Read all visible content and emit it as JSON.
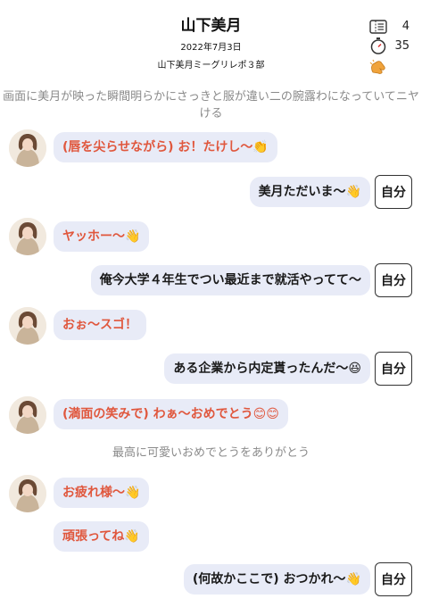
{
  "header": {
    "title": "山下美月",
    "date": "2022年7月3日",
    "subtitle": "山下美月ミーグリレポ３部",
    "stats": [
      {
        "icon": "ticket-icon",
        "value": "4"
      },
      {
        "icon": "stopwatch-icon",
        "value": "35"
      },
      {
        "icon": "waving-hand-icon",
        "value": ""
      }
    ]
  },
  "chat": {
    "narration_1": "画面に美月が映った瞬間明らかにさっきと服が違い二の腕露わになっていてニヤける",
    "msg_1": "(唇を尖らせながら) お！たけし〜👏",
    "reply_1": "美月ただいま〜👋",
    "msg_2": "ヤッホー〜👋",
    "reply_2": "俺今大学４年生でつい最近まで就活やってて〜",
    "msg_3": "おぉ〜スゴ！",
    "reply_3": "ある企業から内定貰ったんだ〜😆",
    "msg_4": "(満面の笑みで) わぁ〜おめでとう😊😊",
    "narration_2": "最高に可愛いおめでとうをありがとう",
    "msg_5": "お疲れ様〜👋",
    "msg_6": "頑張ってね👋",
    "reply_4": "(何故かここで) おつかれ〜👋",
    "self_label": "自分"
  }
}
